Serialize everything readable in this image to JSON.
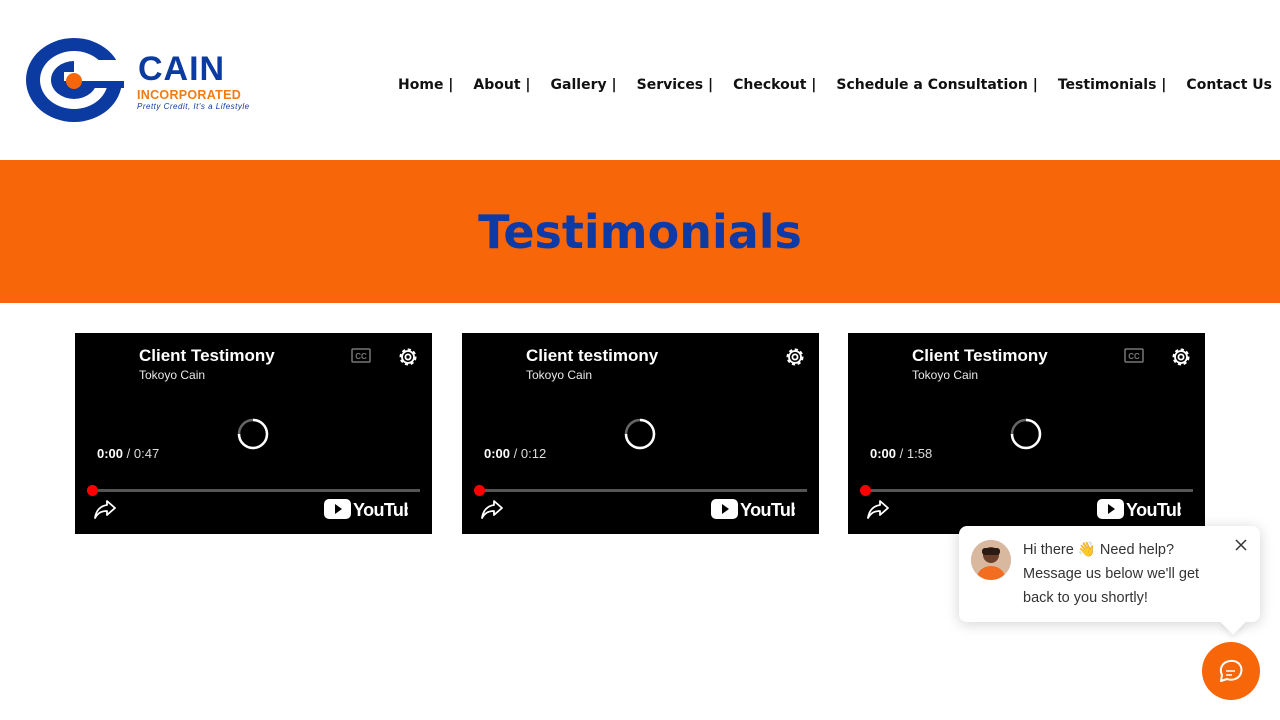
{
  "header": {
    "logo": {
      "brand": "CAIN",
      "sub": "INCORPORATED",
      "tagline": "Pretty Credit, It's a Lifestyle"
    },
    "nav": [
      {
        "label": "Home |"
      },
      {
        "label": "About |"
      },
      {
        "label": "Gallery |"
      },
      {
        "label": "Services |"
      },
      {
        "label": "Checkout |"
      },
      {
        "label": "Schedule a Consultation |"
      },
      {
        "label": "Testimonials |"
      },
      {
        "label": "Contact Us"
      }
    ]
  },
  "banner": {
    "title": "Testimonials",
    "background": "#f8660a",
    "title_color": "#0d3aa5"
  },
  "videos": [
    {
      "title": "Client Testimony",
      "channel": "Tokoyo Cain",
      "current": "0:00",
      "duration": "/ 0:47",
      "has_cc": true,
      "brand": "YouTube"
    },
    {
      "title": "Client testimony",
      "channel": "Tokoyo Cain",
      "current": "0:00",
      "duration": "/ 0:12",
      "has_cc": false,
      "brand": "YouTube"
    },
    {
      "title": "Client Testimony",
      "channel": "Tokoyo Cain",
      "current": "0:00",
      "duration": "/ 1:58",
      "has_cc": true,
      "brand": "YouTube"
    }
  ],
  "chat": {
    "message": "Hi there 👋 Need help? Message us below we'll get back to you shortly!",
    "icons": {
      "close": "close-icon",
      "launcher": "chat-icon"
    },
    "accent": "#f8660a"
  }
}
